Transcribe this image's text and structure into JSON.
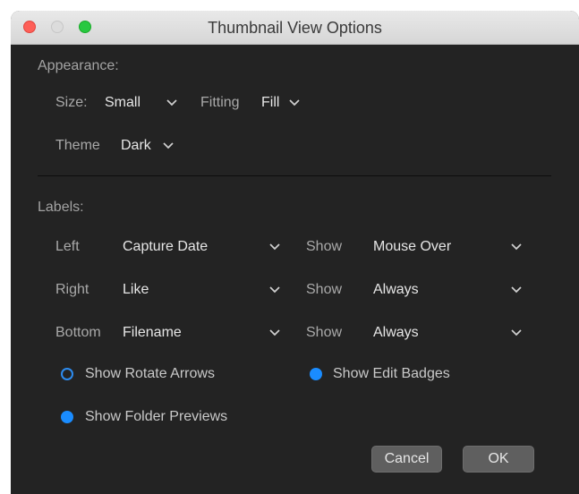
{
  "window": {
    "title": "Thumbnail View Options"
  },
  "appearance": {
    "heading": "Appearance:",
    "size_label": "Size:",
    "size_value": "Small",
    "fitting_label": "Fitting",
    "fitting_value": "Fill",
    "theme_label": "Theme",
    "theme_value": "Dark"
  },
  "labels": {
    "heading": "Labels:",
    "rows": [
      {
        "position": "Left",
        "value": "Capture Date",
        "show_label": "Show",
        "show_value": "Mouse Over"
      },
      {
        "position": "Right",
        "value": "Like",
        "show_label": "Show",
        "show_value": "Always"
      },
      {
        "position": "Bottom",
        "value": "Filename",
        "show_label": "Show",
        "show_value": "Always"
      }
    ]
  },
  "options": {
    "show_rotate_arrows": {
      "label": "Show Rotate Arrows",
      "checked": false
    },
    "show_edit_badges": {
      "label": "Show Edit Badges",
      "checked": true
    },
    "show_folder_previews": {
      "label": "Show Folder Previews",
      "checked": true
    }
  },
  "buttons": {
    "cancel": "Cancel",
    "ok": "OK"
  },
  "colors": {
    "background": "#232323",
    "accent": "#1a8cff",
    "button": "#5f5f5f"
  },
  "icons": {
    "dropdown": "chevron-down-icon",
    "traffic_lights": [
      "close-icon",
      "minimize-icon",
      "zoom-icon"
    ]
  }
}
